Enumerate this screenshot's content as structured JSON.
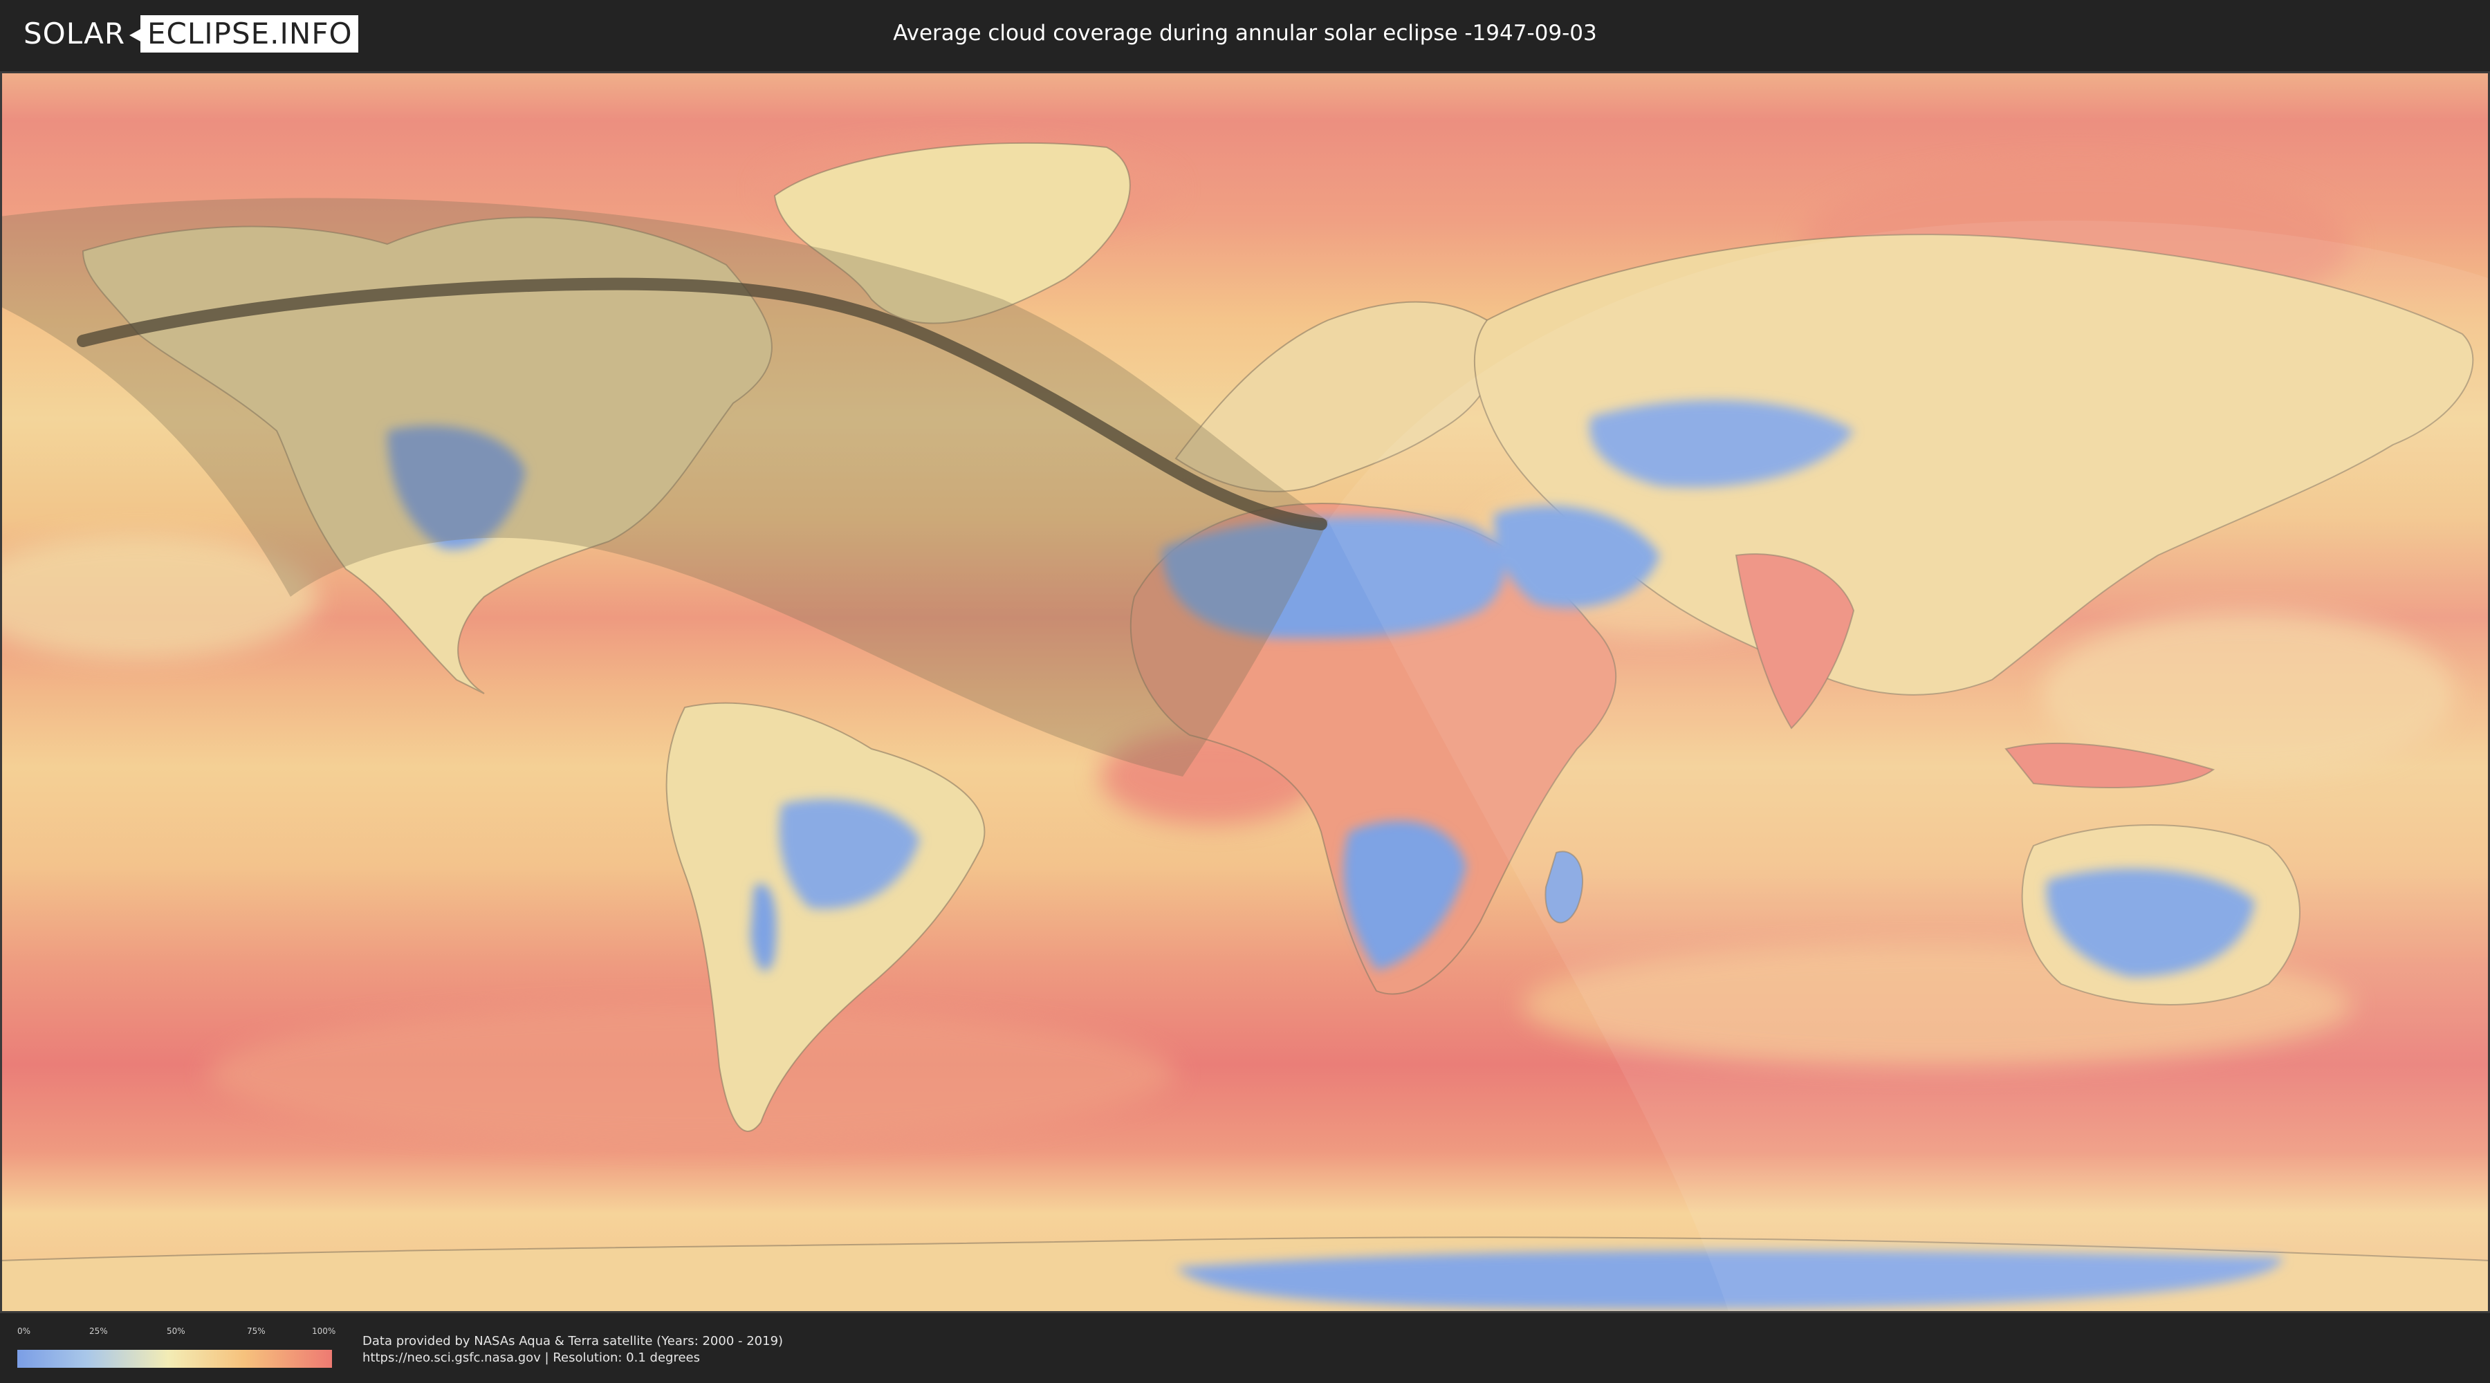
{
  "header": {
    "logo_part1": "SOLAR",
    "logo_part2": "ECLIPSE.INFO",
    "title": "Average cloud coverage during annular solar eclipse -1947-09-03"
  },
  "legend": {
    "ticks": [
      "0%",
      "25%",
      "50%",
      "75%",
      "100%"
    ],
    "colors": [
      "#7b9ee6",
      "#a9c7e9",
      "#f3ecb5",
      "#f6c27d",
      "#ee7a72"
    ]
  },
  "credits": {
    "line1": "Data provided by NASAs Aqua & Terra satellite (Years: 2000 - 2019)",
    "line2": "https://neo.sci.gsfc.nasa.gov | Resolution: 0.1 degrees"
  },
  "map": {
    "projection": "equirectangular",
    "colors": {
      "ocean_mid": "#f3c98f",
      "ocean_high": "#ee8a7e",
      "clear": "#7ea3e4",
      "land_moderate": "#efe0a8",
      "eclipse_shadow": "#7d6f55",
      "central_path": "#4d4634"
    }
  }
}
